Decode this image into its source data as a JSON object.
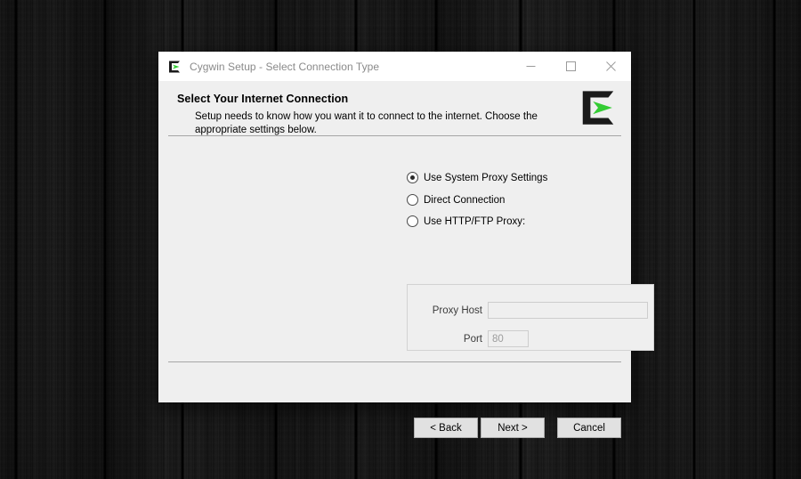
{
  "window": {
    "title": "Cygwin Setup - Select Connection Type",
    "icon": "cygwin-logo-icon",
    "controls": {
      "minimize": "minimize-icon",
      "maximize": "maximize-icon",
      "close": "close-icon"
    }
  },
  "header": {
    "title": "Select Your Internet Connection",
    "subtitle": "Setup needs to know how you want it to connect to the internet.  Choose the appropriate settings below.",
    "logo": "cygwin-logo-icon"
  },
  "main": {
    "connection_options": [
      {
        "id": "system-proxy",
        "label": "Use System Proxy Settings",
        "selected": true
      },
      {
        "id": "direct-connection",
        "label": "Direct Connection",
        "selected": false
      },
      {
        "id": "http-ftp-proxy",
        "label": "Use HTTP/FTP Proxy:",
        "selected": false
      }
    ],
    "proxy_group": {
      "fields": [
        {
          "id": "proxy-host",
          "label": "Proxy Host",
          "value": "",
          "placeholder": ""
        },
        {
          "id": "proxy-port",
          "label": "Port",
          "value": "80",
          "placeholder": "80"
        }
      ]
    }
  },
  "footer": {
    "buttons": [
      {
        "id": "back",
        "label": "< Back"
      },
      {
        "id": "next",
        "label": "Next >"
      },
      {
        "id": "cancel",
        "label": "Cancel"
      }
    ]
  },
  "colors": {
    "dialog_body": "#efefef",
    "titlebar": "#ffffff",
    "title_text": "#8a8a8a",
    "logo_green": "#33cc33",
    "logo_black": "#1a1a1a",
    "separator": "#a6a6a6",
    "desktop": "#151515"
  }
}
